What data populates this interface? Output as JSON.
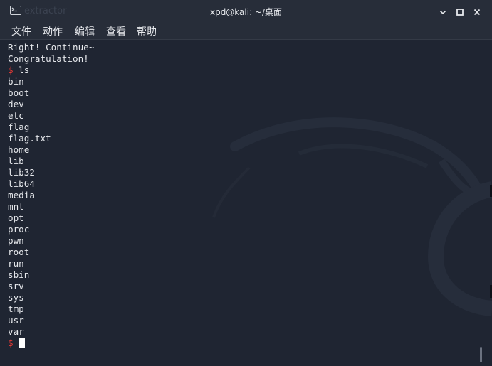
{
  "window": {
    "title": "xpd@kali: ~/桌面",
    "background_ghost": "extractor"
  },
  "menu": [
    "文件",
    "动作",
    "编辑",
    "查看",
    "帮助"
  ],
  "terminal": {
    "lines": [
      {
        "type": "output",
        "text": "Right! Continue~"
      },
      {
        "type": "output",
        "text": "Congratulation!"
      },
      {
        "type": "prompt",
        "prompt": "$",
        "command": "ls"
      },
      {
        "type": "output",
        "text": "bin"
      },
      {
        "type": "output",
        "text": "boot"
      },
      {
        "type": "output",
        "text": "dev"
      },
      {
        "type": "output",
        "text": "etc"
      },
      {
        "type": "output",
        "text": "flag"
      },
      {
        "type": "output",
        "text": "flag.txt"
      },
      {
        "type": "output",
        "text": "home"
      },
      {
        "type": "output",
        "text": "lib"
      },
      {
        "type": "output",
        "text": "lib32"
      },
      {
        "type": "output",
        "text": "lib64"
      },
      {
        "type": "output",
        "text": "media"
      },
      {
        "type": "output",
        "text": "mnt"
      },
      {
        "type": "output",
        "text": "opt"
      },
      {
        "type": "output",
        "text": "proc"
      },
      {
        "type": "output",
        "text": "pwn"
      },
      {
        "type": "output",
        "text": "root"
      },
      {
        "type": "output",
        "text": "run"
      },
      {
        "type": "output",
        "text": "sbin"
      },
      {
        "type": "output",
        "text": "srv"
      },
      {
        "type": "output",
        "text": "sys"
      },
      {
        "type": "output",
        "text": "tmp"
      },
      {
        "type": "output",
        "text": "usr"
      },
      {
        "type": "output",
        "text": "var"
      },
      {
        "type": "cursor",
        "prompt": "$",
        "command": ""
      }
    ]
  },
  "colors": {
    "background": "#1f2532",
    "titlebar": "#272d39",
    "text": "#e6e8ec",
    "prompt": "#e53935",
    "cursor": "#ffffff"
  }
}
